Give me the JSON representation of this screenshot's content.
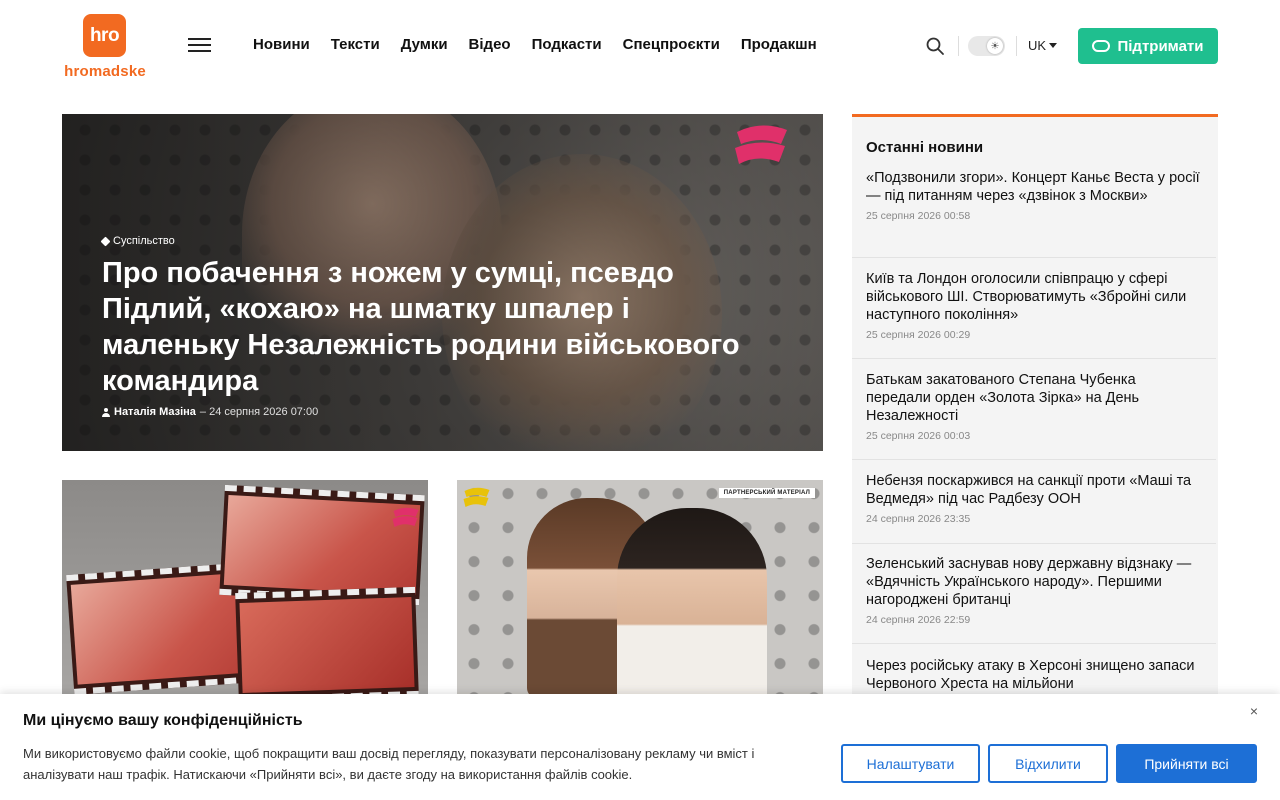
{
  "header": {
    "logo_box": "hro",
    "logo_text": "hromadske",
    "nav": [
      "Новини",
      "Тексти",
      "Думки",
      "Відео",
      "Подкасти",
      "Спецпроєкти",
      "Продакшн"
    ],
    "lang": "UK",
    "support_label": "Підтримати"
  },
  "hero": {
    "category": "Суспільство",
    "title": "Про побачення з ножем у сумці, псевдо Підлий, «кохаю» на шматку шпалер і маленьку Незалежність родини військового командира",
    "author": "Наталія Мазіна",
    "date": "– 24 серпня 2026 07:00"
  },
  "cards": [
    {
      "partner_label": ""
    },
    {
      "partner_label": "ПАРТНЕРСЬКИЙ МАТЕРІАЛ"
    }
  ],
  "sidebar": {
    "title": "Останні новини",
    "items": [
      {
        "title": "«Подзвонили згори». Концерт Каньє Веста у росії — під питанням через «дзвінок з Москви»",
        "date": "25 серпня 2026 00:58"
      },
      {
        "title": "Київ та Лондон оголосили співпрацю у сфері військового ШІ. Створюватимуть «Збройні сили наступного покоління»",
        "date": "25 серпня 2026 00:29"
      },
      {
        "title": "Батькам закатованого Степана Чубенка передали орден «Золота Зірка» на День Незалежності",
        "date": "25 серпня 2026 00:03"
      },
      {
        "title": "Небензя поскаржився на санкції проти «Маші та Ведмедя» під час Радбезу ООН",
        "date": "24 серпня 2026 23:35"
      },
      {
        "title": "Зеленський заснував нову державну відзнаку — «Вдячність Українського народу». Першими нагороджені британці",
        "date": "24 серпня 2026 22:59"
      },
      {
        "title": "Через російську атаку в Херсоні знищено запаси Червоного Хреста на мільйони",
        "date": ""
      }
    ]
  },
  "cookie": {
    "title": "Ми цінуємо вашу конфіденційність",
    "text": "Ми використовуємо файли cookie, щоб покращити ваш досвід перегляду, показувати персоналізовану рекламу чи вміст і аналізувати наш трафік. Натискаючи «Прийняти всі», ви даєте згоду на використання файлів cookie.",
    "customize": "Налаштувати",
    "reject": "Відхилити",
    "accept": "Прийняти всі",
    "close": "×"
  },
  "colors": {
    "brand_orange": "#f26a21",
    "support_green": "#1fbf8f",
    "cookie_blue": "#1d6fd6",
    "sidebar_bg": "#f4f4f4"
  }
}
